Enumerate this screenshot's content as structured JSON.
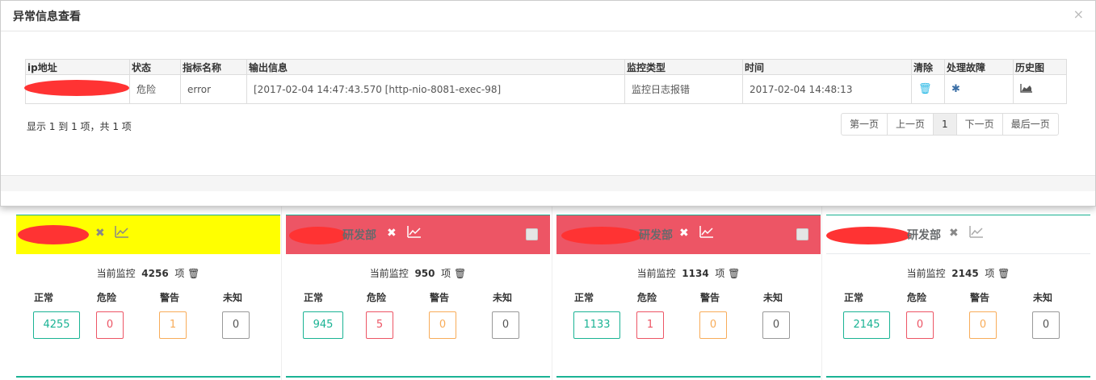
{
  "modal": {
    "title": "异常信息查看",
    "close_glyph": "×",
    "columns": [
      "ip地址",
      "状态",
      "指标名称",
      "输出信息",
      "监控类型",
      "时间",
      "清除",
      "处理故障",
      "历史图"
    ],
    "row": {
      "status": "危险",
      "metric": "error",
      "output": "[2017-02-04 14:47:43.570 [http-nio-8081-exec-98]",
      "monitor_type": "监控日志报错",
      "time": "2017-02-04 14:48:13",
      "clear_icon": "trash-icon",
      "fix_icon": "bug-icon",
      "history_icon": "area-chart-icon"
    },
    "pager_info": "显示 1 到 1 项，共 1 项",
    "pager": [
      "第一页",
      "上一页",
      "1",
      "下一页",
      "最后一页"
    ]
  },
  "colors": {
    "green": "#1ab394",
    "red": "#ed5565",
    "orange": "#f8ac59",
    "yellow": "#ffff00",
    "danger_text": "#a94442"
  },
  "cards": [
    {
      "name": "",
      "monitor_prefix": "当前监控",
      "count": "4256",
      "suffix": "项",
      "labels": [
        "正常",
        "危险",
        "警告",
        "未知"
      ],
      "values": [
        "4255",
        "0",
        "1",
        "0"
      ]
    },
    {
      "name": "研发部",
      "monitor_prefix": "当前监控",
      "count": "950",
      "suffix": "项",
      "labels": [
        "正常",
        "危险",
        "警告",
        "未知"
      ],
      "values": [
        "945",
        "5",
        "0",
        "0"
      ]
    },
    {
      "name": "研发部",
      "monitor_prefix": "当前监控",
      "count": "1134",
      "suffix": "项",
      "labels": [
        "正常",
        "危险",
        "警告",
        "未知"
      ],
      "values": [
        "1133",
        "1",
        "0",
        "0"
      ]
    },
    {
      "name": "研发部",
      "monitor_prefix": "当前监控",
      "count": "2145",
      "suffix": "项",
      "labels": [
        "正常",
        "危险",
        "警告",
        "未知"
      ],
      "values": [
        "2145",
        "0",
        "0",
        "0"
      ]
    }
  ]
}
